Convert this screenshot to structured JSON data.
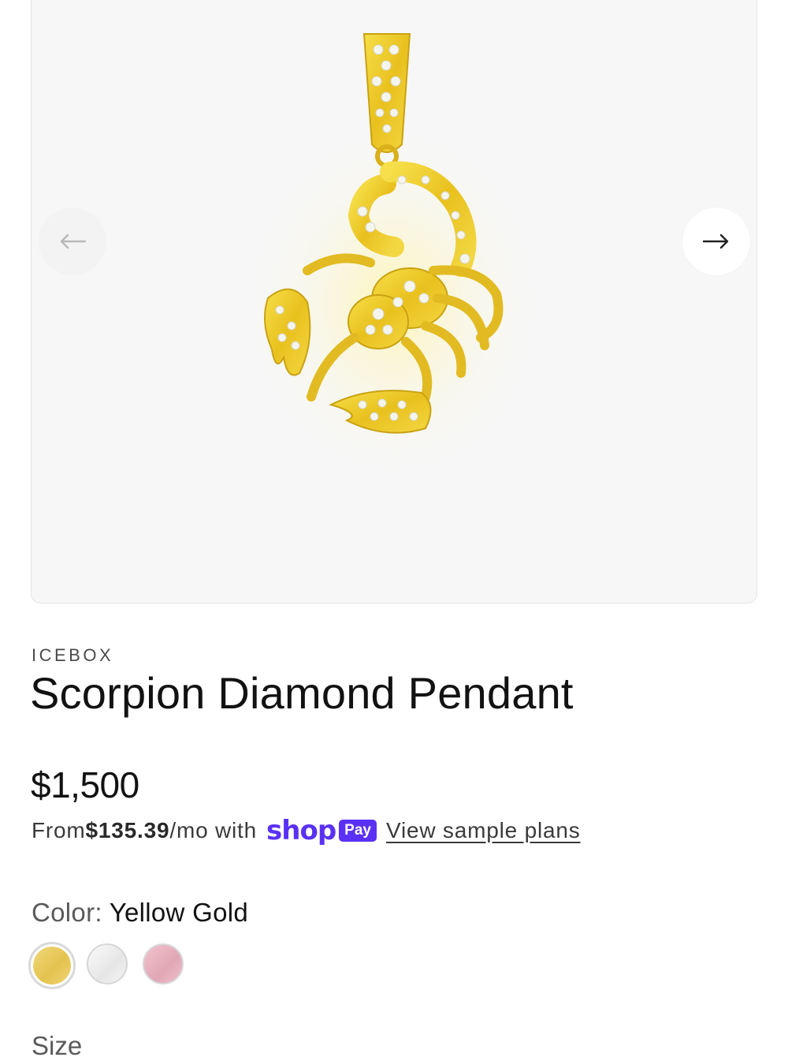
{
  "gallery": {
    "image_alt": "Scorpion Diamond Pendant",
    "prev_icon": "arrow-left-icon",
    "next_icon": "arrow-right-icon"
  },
  "product": {
    "vendor": "ICEBOX",
    "title": "Scorpion Diamond Pendant",
    "price": "$1,500"
  },
  "installments": {
    "prefix": "From ",
    "amount": "$135.39",
    "suffix": "/mo with",
    "shop_word": "shop",
    "pay_word": "Pay",
    "link": "View sample plans",
    "brand_color": "#5a31f4"
  },
  "options": {
    "color_label": "Color:",
    "color_value": "Yellow Gold",
    "swatches": [
      "Yellow Gold",
      "White Gold",
      "Rose Gold"
    ],
    "size_label": "Size"
  }
}
